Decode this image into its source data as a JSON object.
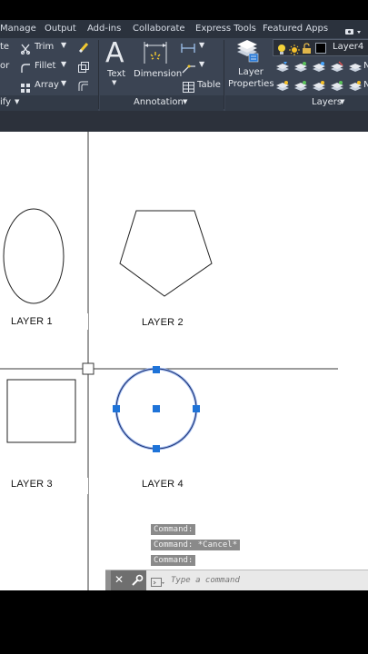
{
  "ribbon": {
    "tabs": [
      "Manage",
      "Output",
      "Add-ins",
      "Collaborate",
      "Express Tools",
      "Featured Apps"
    ],
    "modify": {
      "row1_left": "te",
      "trim": "Trim",
      "row2_left": "or",
      "fillet": "Fillet",
      "array": "Array",
      "panel_title": "ify"
    },
    "annotation": {
      "text": "Text",
      "dimension": "Dimension",
      "table": "Table",
      "panel_title": "Annotation"
    },
    "layers": {
      "layer_properties_line1": "Layer",
      "layer_properties_line2": "Properties",
      "current_layer": "Layer4",
      "cut_labels": [
        "N",
        "N",
        "N"
      ],
      "panel_title": "Layers"
    }
  },
  "drawing": {
    "labels": [
      "LAYER 1",
      "LAYER 2",
      "LAYER 3",
      "LAYER 4"
    ]
  },
  "command": {
    "history": [
      "Command:",
      "Command: *Cancel*",
      "Command:"
    ],
    "placeholder": "Type a command"
  },
  "colors": {
    "ribbon_bg": "#3b4453",
    "canvas_bg": "#ffffff",
    "grip_blue": "#1e73d8",
    "selection_outline": "#1c2f6e"
  }
}
